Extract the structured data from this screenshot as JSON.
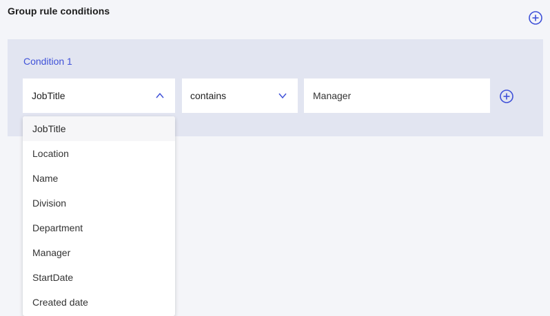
{
  "section": {
    "title": "Group rule conditions"
  },
  "condition": {
    "label": "Condition 1",
    "attribute": "JobTitle",
    "operator": "contains",
    "value": "Manager"
  },
  "dropdown": {
    "items": [
      {
        "label": "JobTitle",
        "selected": true
      },
      {
        "label": "Location"
      },
      {
        "label": "Name"
      },
      {
        "label": "Division"
      },
      {
        "label": "Department"
      },
      {
        "label": "Manager"
      },
      {
        "label": "StartDate"
      },
      {
        "label": "Created date"
      }
    ]
  },
  "icons": {
    "add_group": "plus-circle-icon",
    "add_condition": "plus-circle-icon",
    "attribute_chevron": "chevron-up-icon",
    "operator_chevron": "chevron-down-icon"
  },
  "colors": {
    "accent": "#3f51d8",
    "panel": "#e2e5f1",
    "page_background": "#f4f5f9"
  }
}
